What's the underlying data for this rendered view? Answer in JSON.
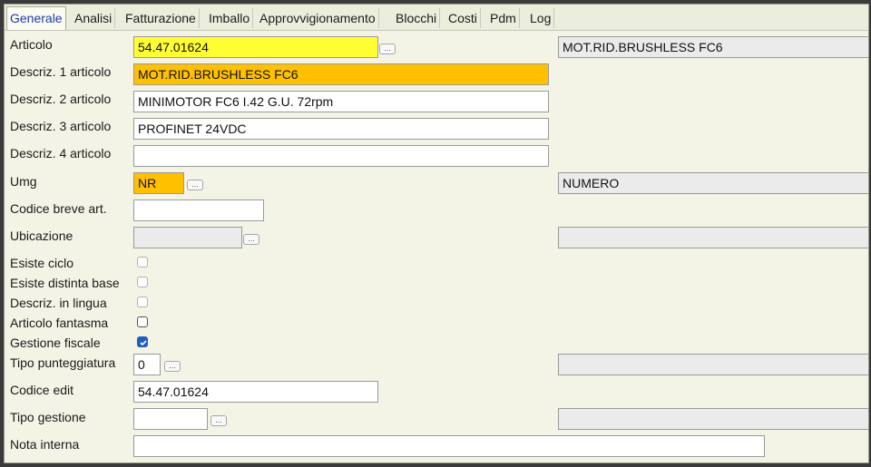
{
  "tabs": [
    {
      "id": "generale",
      "label": "Generale",
      "active": true
    },
    {
      "id": "analisi",
      "label": "Analisi"
    },
    {
      "id": "fatturazione",
      "label": "Fatturazione"
    },
    {
      "id": "imballo",
      "label": "Imballo"
    },
    {
      "id": "approvvigionamento",
      "label": "Approvvigionamento"
    },
    {
      "id": "blocchi",
      "label": "Blocchi"
    },
    {
      "id": "costi",
      "label": "Costi"
    },
    {
      "id": "pdm",
      "label": "Pdm"
    },
    {
      "id": "log",
      "label": "Log"
    }
  ],
  "form": {
    "articolo": {
      "label": "Articolo",
      "value": "54.47.01624",
      "lookup_button": "...",
      "description": "MOT.RID.BRUSHLESS FC6"
    },
    "descr1": {
      "label": "Descriz. 1 articolo",
      "value": "MOT.RID.BRUSHLESS FC6"
    },
    "descr2": {
      "label": "Descriz. 2 articolo",
      "value": "MINIMOTOR FC6  I.42   G.U. 72rpm"
    },
    "descr3": {
      "label": "Descriz. 3 articolo",
      "value": "PROFINET  24VDC"
    },
    "descr4": {
      "label": "Descriz. 4 articolo",
      "value": ""
    },
    "umg": {
      "label": "Umg",
      "value": "NR",
      "lookup_button": "...",
      "description": "NUMERO"
    },
    "codice_breve": {
      "label": "Codice  breve  art.",
      "value": ""
    },
    "ubicazione": {
      "label": "Ubicazione",
      "value": "",
      "lookup_button": "...",
      "description": ""
    },
    "esiste_ciclo": {
      "label": "Esiste ciclo",
      "checked": false
    },
    "esiste_distinta": {
      "label": "Esiste distinta base",
      "checked": false
    },
    "descr_lingua": {
      "label": "Descriz. in lingua",
      "checked": false
    },
    "articolo_fantasma": {
      "label": "Articolo fantasma",
      "checked": false
    },
    "gestione_fiscale": {
      "label": "Gestione fiscale",
      "checked": true
    },
    "tipo_punteggiatura": {
      "label": "Tipo punteggiatura",
      "value": "0",
      "lookup_button": "...",
      "description": ""
    },
    "codice_edit": {
      "label": "Codice edit",
      "value": "54.47.01624"
    },
    "tipo_gestione": {
      "label": "Tipo gestione",
      "value": "",
      "lookup_button": "...",
      "description": ""
    },
    "nota_interna": {
      "label": "Nota interna",
      "value": ""
    }
  },
  "colors": {
    "required_field": "#ffff33",
    "key_field": "#ffc000",
    "readonly_field": "#ebebeb",
    "checkbox_checked": "#1f5fbf"
  }
}
